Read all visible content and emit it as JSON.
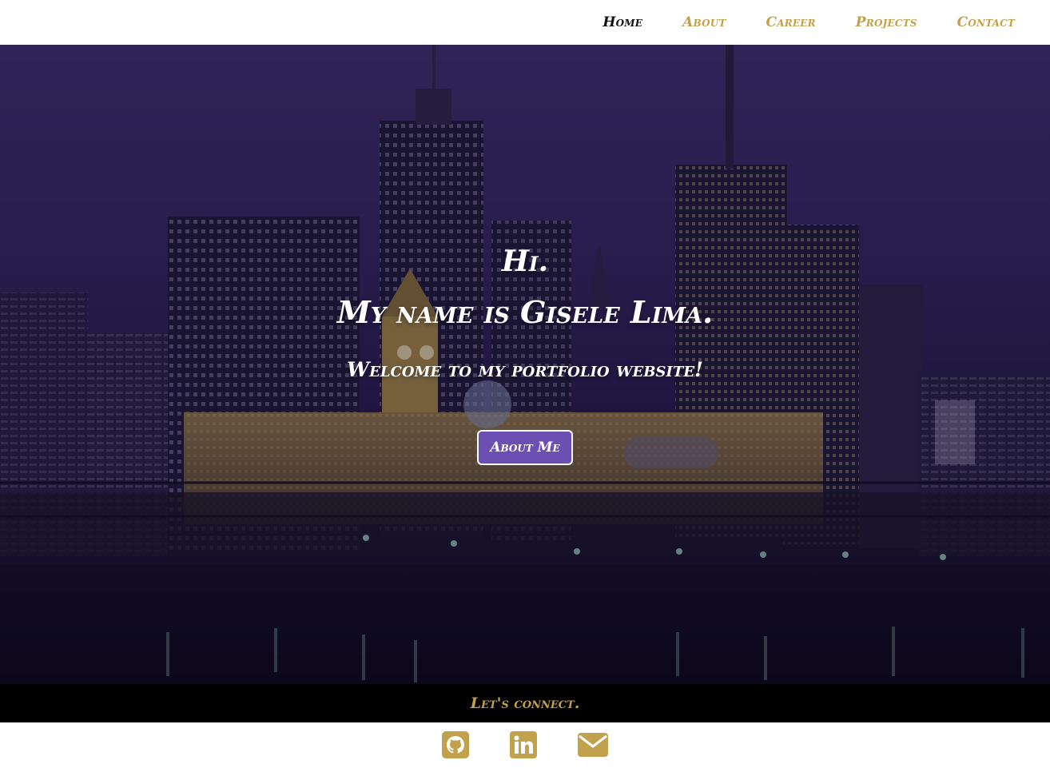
{
  "nav": {
    "items": [
      {
        "label": "Home",
        "active": true
      },
      {
        "label": "About",
        "active": false
      },
      {
        "label": "Career",
        "active": false
      },
      {
        "label": "Projects",
        "active": false
      },
      {
        "label": "Contact",
        "active": false
      }
    ]
  },
  "hero": {
    "greeting": "Hi.",
    "name_line": "My name is Gisele Lima.",
    "welcome": "Welcome to my portfolio website!",
    "button_label": "About Me",
    "background": "city-skyline-night-image"
  },
  "footer": {
    "connect_text": "Let's connect.",
    "social": [
      {
        "icon": "github-icon"
      },
      {
        "icon": "linkedin-icon"
      },
      {
        "icon": "envelope-icon"
      }
    ]
  },
  "colors": {
    "accent_gold": "#c2a14d",
    "button_purple": "#6b4fb3",
    "nav_active": "#111111",
    "connect_bar": "#000000"
  }
}
